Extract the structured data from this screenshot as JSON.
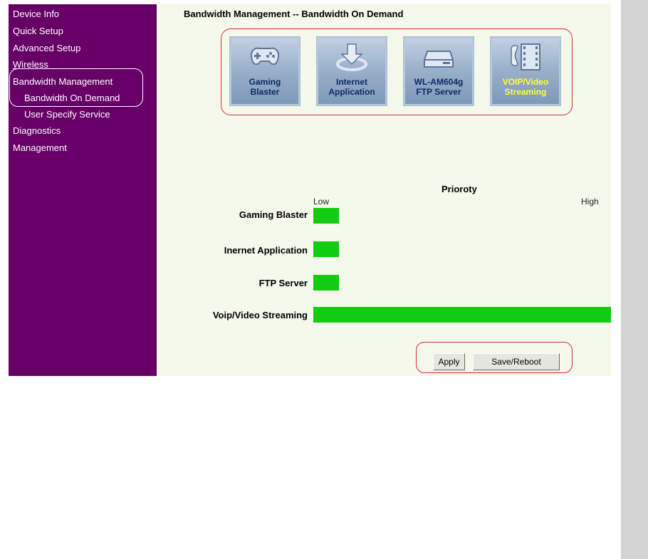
{
  "nav": {
    "items": [
      {
        "label": "Device Info"
      },
      {
        "label": "Quick Setup"
      },
      {
        "label": "Advanced Setup"
      },
      {
        "label": "Wireless"
      },
      {
        "label": "Bandwidth Management"
      },
      {
        "label": "Bandwidth On Demand"
      },
      {
        "label": "User Specify Service"
      },
      {
        "label": "Diagnostics"
      },
      {
        "label": "Management"
      }
    ]
  },
  "page": {
    "title": "Bandwidth Management -- Bandwidth On Demand"
  },
  "apps": [
    {
      "line1": "Gaming",
      "line2": "Blaster",
      "icon": "gamepad-icon",
      "selected": false
    },
    {
      "line1": "Internet",
      "line2": "Application",
      "icon": "download-icon",
      "selected": false
    },
    {
      "line1": "WL-AM604g",
      "line2": "FTP Server",
      "icon": "server-icon",
      "selected": false
    },
    {
      "line1": "VOIP/Video",
      "line2": "Streaming",
      "icon": "phone-film-icon",
      "selected": true
    }
  ],
  "priority": {
    "title": "Prioroty",
    "low_label": "Low",
    "high_label": "High",
    "bar_color": "#11cc11",
    "rows": [
      {
        "label": "Gaming Blaster",
        "level": 0.085
      },
      {
        "label": "Inernet Application",
        "level": 0.085
      },
      {
        "label": "FTP Server",
        "level": 0.085
      },
      {
        "label": "Voip/Video Streaming",
        "level": 1.0
      }
    ]
  },
  "buttons": {
    "apply": "Apply",
    "save_reboot": "Save/Reboot"
  },
  "colors": {
    "sidebar": "#660066",
    "content_bg": "#f4f9eb",
    "highlight_border": "#d43030",
    "selected_app_text": "#ffff33"
  }
}
